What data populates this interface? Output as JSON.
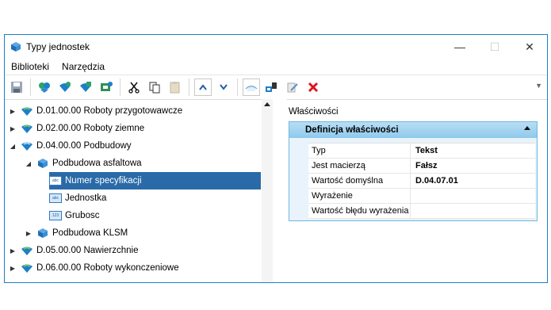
{
  "window": {
    "title": "Typy jednostek",
    "controls": {
      "minimize": "—",
      "maximize": "☐",
      "close": "✕"
    }
  },
  "menu": [
    "Biblioteki",
    "Narzędzia"
  ],
  "toolbar": [
    "save-icon",
    "add-library-icon",
    "add-group-icon",
    "add-type-icon",
    "add-field-icon",
    "cut-icon",
    "copy-icon",
    "paste-icon",
    "move-up-icon",
    "move-down-icon",
    "view-icon",
    "properties-icon",
    "edit-icon",
    "delete-icon"
  ],
  "tree": [
    {
      "label": "D.01.00.00 Roboty przygotowawcze",
      "level": 0,
      "expanded": false,
      "kind": "group"
    },
    {
      "label": "D.02.00.00 Roboty ziemne",
      "level": 0,
      "expanded": false,
      "kind": "group"
    },
    {
      "label": "D.04.00.00 Podbudowy",
      "level": 0,
      "expanded": true,
      "kind": "group"
    },
    {
      "label": "Podbudowa asfaltowa",
      "level": 1,
      "expanded": true,
      "kind": "type"
    },
    {
      "label": "Numer specyfikacji",
      "level": 2,
      "kind": "field",
      "selected": true
    },
    {
      "label": "Jednostka",
      "level": 2,
      "kind": "field"
    },
    {
      "label": "Grubosc",
      "level": 2,
      "kind": "field"
    },
    {
      "label": "Podbudowa KLSM",
      "level": 1,
      "expanded": false,
      "kind": "type"
    },
    {
      "label": "D.05.00.00 Nawierzchnie",
      "level": 0,
      "expanded": false,
      "kind": "group"
    },
    {
      "label": "D.06.00.00 Roboty wykonczeniowe",
      "level": 0,
      "expanded": false,
      "kind": "group"
    }
  ],
  "properties": {
    "label": "Właściwości",
    "header": "Definicja właściwości",
    "rows": [
      {
        "key": "Typ",
        "value": "Tekst"
      },
      {
        "key": "Jest macierzą",
        "value": "Fałsz"
      },
      {
        "key": "Wartość domyślna",
        "value": "D.04.07.01"
      },
      {
        "key": "Wyrażenie",
        "value": ""
      },
      {
        "key": "Wartość błędu wyrażenia",
        "value": ""
      }
    ]
  },
  "colors": {
    "accent": "#1c7fc4",
    "selection": "#2a6aa8",
    "panel_header": "#a7d5f0"
  }
}
